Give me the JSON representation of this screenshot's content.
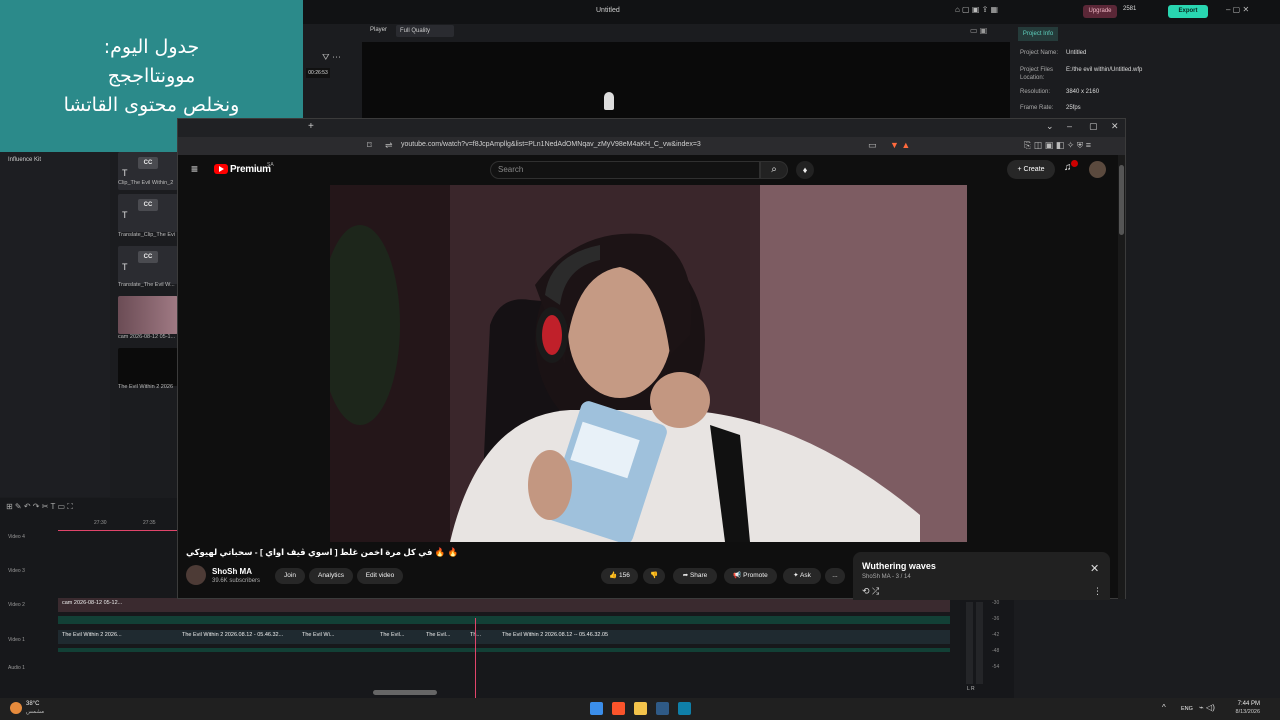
{
  "note": {
    "line1": "جدول اليوم:",
    "line2": "موونتااججج",
    "line3": "ونخلص محتوى القاتشا"
  },
  "editor": {
    "title": "Untitled",
    "upgrade_label": "Upgrade",
    "credits": "2581",
    "export_label": "Export",
    "player_label": "Player",
    "quality": "Full Quality",
    "timecode": "00:26:53",
    "sidebar_item": "Influence Kit",
    "project_info": {
      "tab": "Project Info",
      "rows": [
        {
          "key": "Project Name:",
          "value": "Untitled"
        },
        {
          "key": "Project Files Location:",
          "value": "E:/the evil within/Untitled.wfp"
        },
        {
          "key": "Resolution:",
          "value": "3840 x 2160"
        },
        {
          "key": "Frame Rate:",
          "value": "25fps"
        }
      ]
    },
    "library": [
      {
        "label": "Clip_The Evil Within_2",
        "badge": "CC"
      },
      {
        "label": "Translate_Clip_The Evi",
        "badge": "CC"
      },
      {
        "label": "Translate_The Evil W...",
        "badge": "CC"
      },
      {
        "label": "cam 2026-08-12 05-1...",
        "badge": ""
      },
      {
        "label": "The Evil Within 2 2026",
        "badge": ""
      }
    ],
    "timeline": {
      "ruler": [
        "27:30",
        "27:35"
      ],
      "tracks": [
        "Video 4",
        "Video 3",
        "Video 2",
        "Video 1",
        "Audio 1"
      ],
      "v2_clip": "cam 2026-08-12 05-12...",
      "v1_clips": [
        "The Evil Within 2 2026...",
        "The Evil Within 2 2026.08.12 - 05.46.32...",
        "The Evil Wi...",
        "The Evil...",
        "The Evil...",
        "Th...",
        "The Evil Within 2 2026.08.12 -- 05.46.32.05"
      ],
      "meter_scale": [
        "-30",
        "-36",
        "-42",
        "-48",
        "-54"
      ],
      "meter_lr": "L  R"
    }
  },
  "browser": {
    "url": "youtube.com/watch?v=f8JcpAmpllg&list=PLn1NedAdOMNqav_zMyV98eM4aKH_C_vw&index=3",
    "youtube": {
      "brand": "Premium",
      "brand_sup": "SA",
      "search_placeholder": "Search",
      "create_label": "Create",
      "video_title": "🔥 🔥 في كل مرة اخمن غلط [ اسوي ڤيف اواي ] - سحباتي لهيوكي",
      "channel_name": "ShoSh MA",
      "subscribers": "39.6K subscribers",
      "join_label": "Join",
      "analytics_label": "Analytics",
      "edit_label": "Edit video",
      "likes": "156",
      "share_label": "Share",
      "promote_label": "Promote",
      "ask_label": "Ask",
      "more_label": "...",
      "playlist_title": "Wuthering waves",
      "playlist_sub": "ShoSh MA - 3 / 14"
    }
  },
  "taskbar": {
    "temp": "38°C",
    "condition": "مشمس",
    "lang": "ENG",
    "time": "7:44 PM",
    "date": "8/13/2026"
  }
}
